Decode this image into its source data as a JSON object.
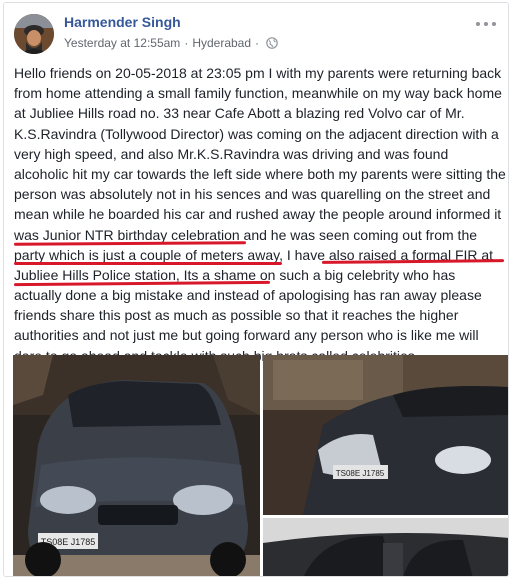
{
  "post": {
    "author": "Harmender Singh",
    "time": "Yesterday at 12:55am",
    "separator": "·",
    "location": "Hyderabad",
    "separator2": "·",
    "privacy_icon": "globe-icon",
    "more_icon": "more-options-icon",
    "lines": [
      "Hello friends on 20-05-2018 at 23:05 pm I with my parents were returning back",
      "from home attending a small family function, meanwhile on my way back home",
      "at Jubliee Hills road no. 33 near Cafe Abott a blazing red Volvo car of Mr.",
      "K.S.Ravindra (Tollywood Director) was coming on the adjacent direction with a",
      "very high speed, and also Mr.K.S.Ravindra was driving and was found",
      "alcoholic hit my car towards the left side where both my parents were sitting the",
      "person was absolutely not in his sences and was quarelling on the street and",
      "mean while he boarded his car and rushed away the people around informed it",
      "was Junior NTR birthday celebration and he was seen coming out from the",
      "party which is just a couple of meters away, I have also raised a formal FIR at",
      "Jubliee Hills Police station, Its a shame on such a big celebrity who has",
      "actually done a big mistake and instead of apologising has ran away please",
      "friends share this post as much as possible so that it reaches the higher",
      "authorities and not just me but going forward any person who is like me will",
      "dare to go ahead and tackle with such big brats called celebrities."
    ],
    "plate_1": "TS08E J1785",
    "plate_2": "TS08E J1785"
  },
  "colors": {
    "author": "#365899",
    "meta": "#616770",
    "text": "#1d2129",
    "underline": "#d7182a"
  }
}
